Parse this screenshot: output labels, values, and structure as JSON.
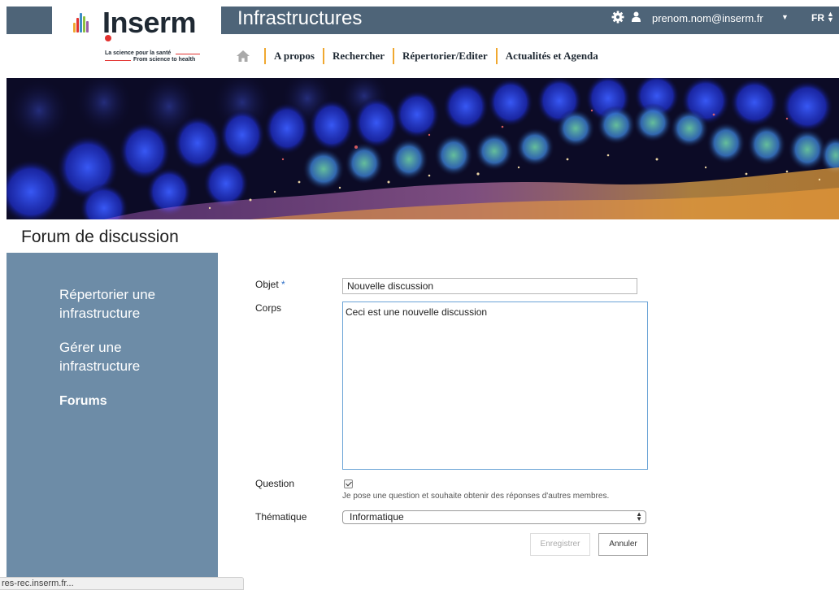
{
  "header": {
    "logo_word": "Inserm",
    "logo_tagline_fr": "La science pour la santé",
    "logo_tagline_en": "From science to health",
    "site_title": "Infrastructures",
    "user_email": "prenom.nom@inserm.fr",
    "language": "FR"
  },
  "nav": {
    "items": [
      {
        "label": "A propos"
      },
      {
        "label": "Rechercher"
      },
      {
        "label": "Répertorier/Editer"
      },
      {
        "label": "Actualités et Agenda"
      }
    ]
  },
  "page": {
    "title": "Forum de discussion"
  },
  "sidebar": {
    "items": [
      {
        "label": "Répertorier une infrastructure"
      },
      {
        "label": "Gérer une infrastructure"
      },
      {
        "label": "Forums"
      }
    ]
  },
  "form": {
    "object_label": "Objet",
    "required_mark": "*",
    "object_value": "Nouvelle discussion",
    "body_label": "Corps",
    "body_value": "Ceci est une nouvelle discussion",
    "question_label": "Question",
    "question_checked": true,
    "question_help": "Je pose une question et souhaite obtenir des réponses d'autres membres.",
    "theme_label": "Thématique",
    "theme_value": "Informatique",
    "save_label": "Enregistrer",
    "cancel_label": "Annuler"
  },
  "status_bar": {
    "url": "res-rec.inserm.fr..."
  },
  "colors": {
    "header_bar": "#4e6478",
    "sidebar": "#6d8ca7",
    "nav_separator": "#f0a830",
    "logo_red": "#e2322f"
  },
  "icons": {
    "settings": "gear-icon",
    "user": "user-icon",
    "home": "home-icon"
  }
}
